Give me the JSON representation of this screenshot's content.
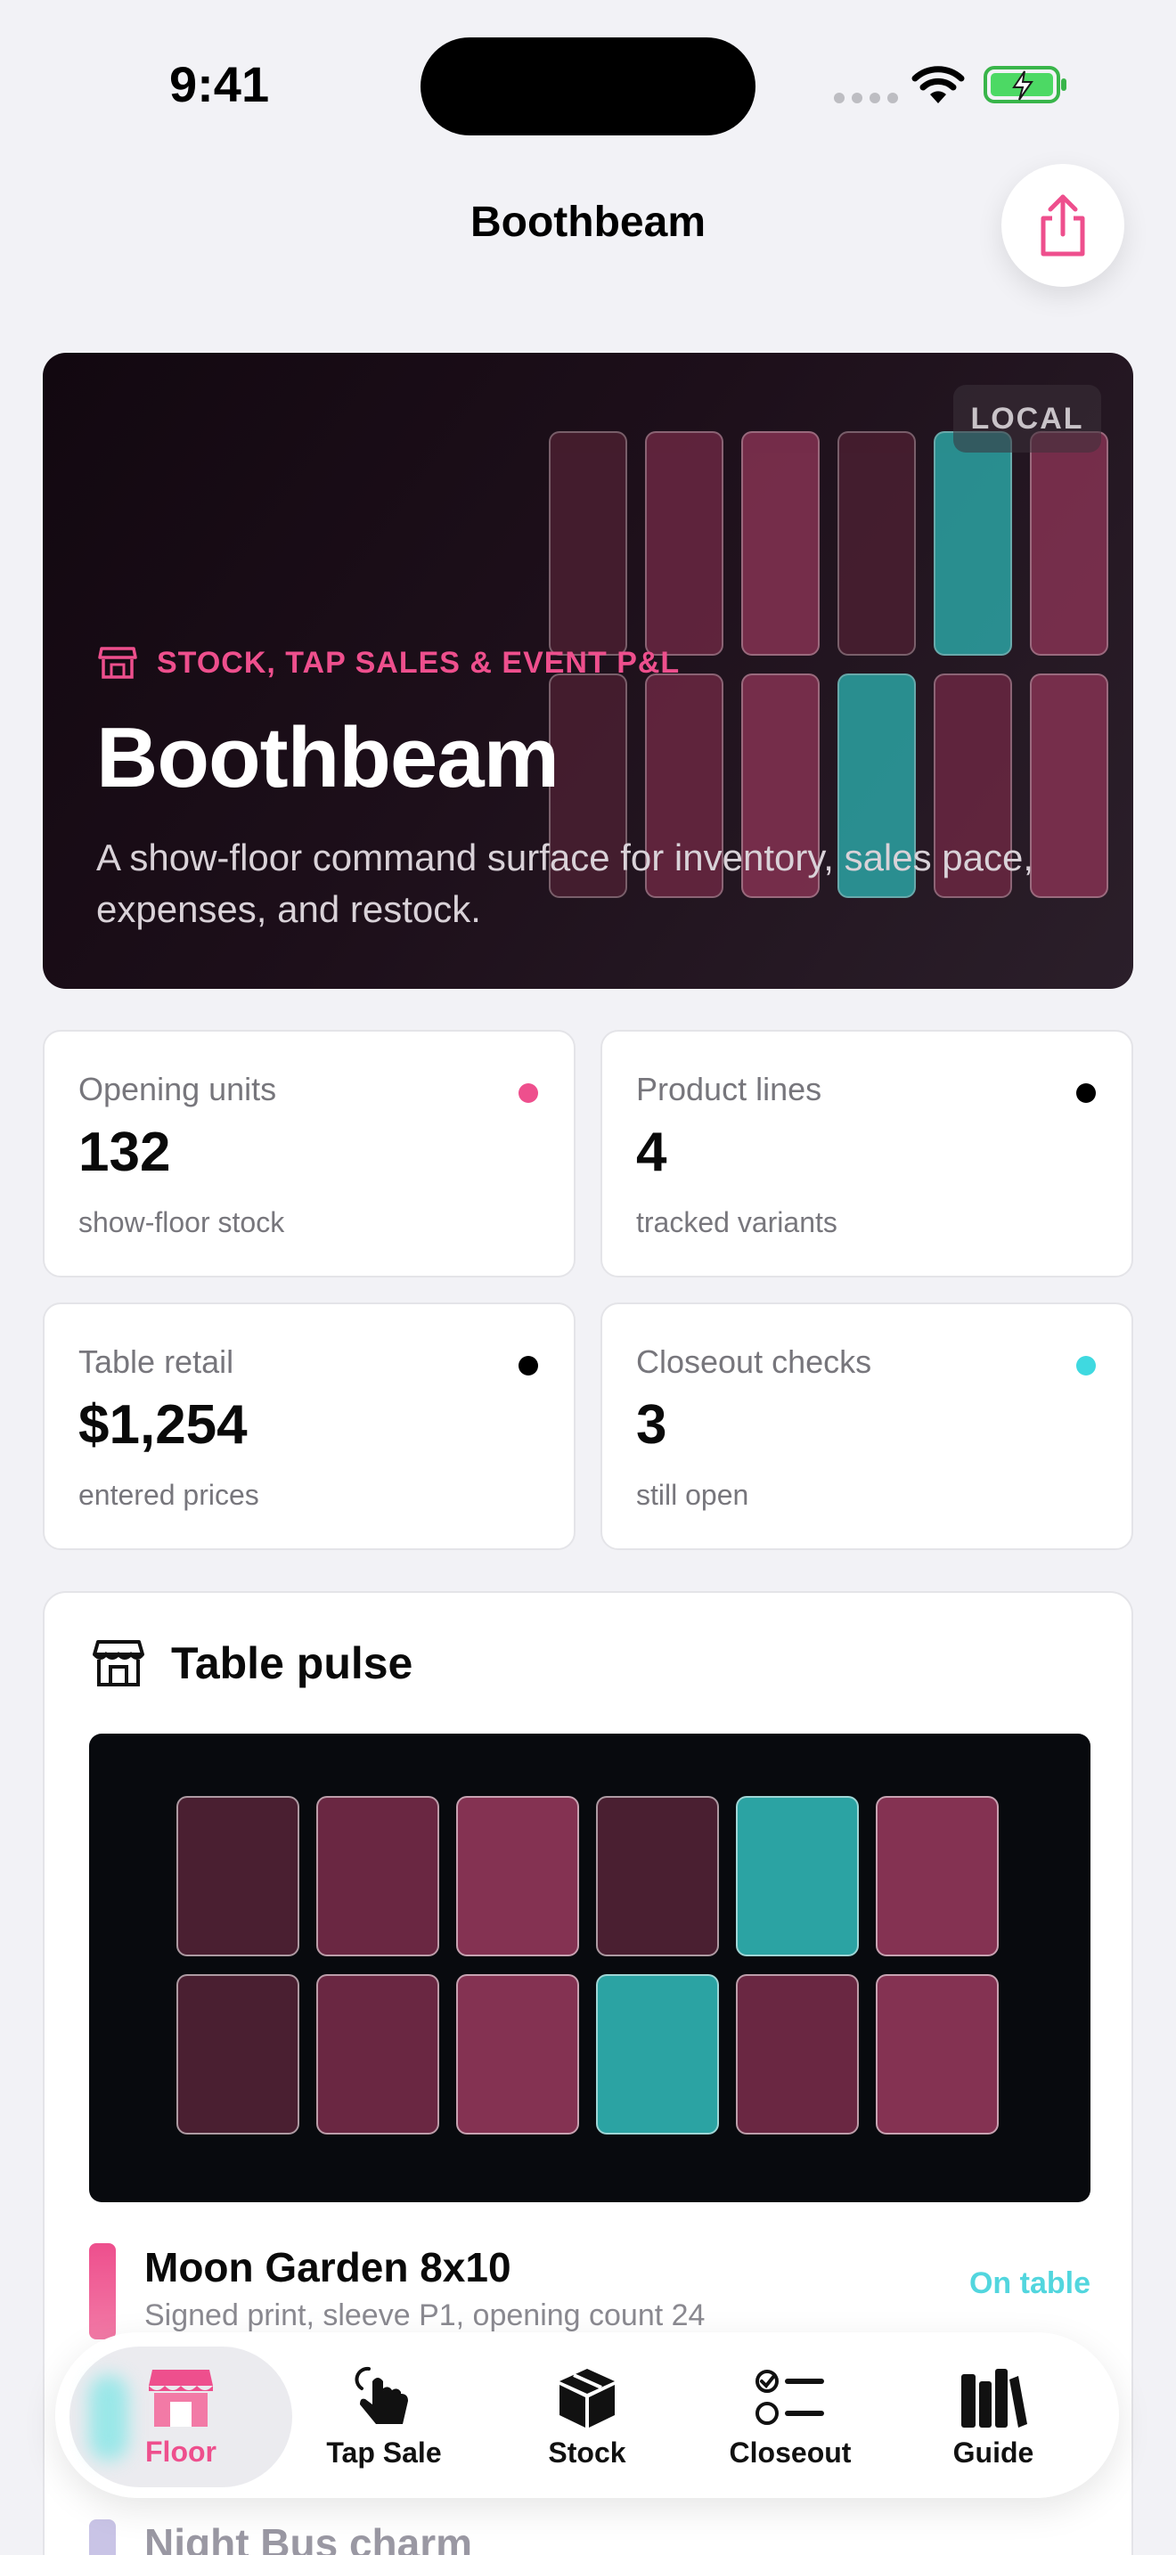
{
  "status_bar": {
    "time": "9:41"
  },
  "header": {
    "title": "Boothbeam",
    "share_icon": "share-icon"
  },
  "hero": {
    "badge": "LOCAL",
    "kicker": "STOCK, TAP SALES & EVENT P&L",
    "title": "Boothbeam",
    "description": "A show-floor command surface for inventory, sales pace, expenses, and restock."
  },
  "stats": [
    {
      "label": "Opening units",
      "value": "132",
      "sub": "show-floor stock",
      "dot_color": "#ee4f8d"
    },
    {
      "label": "Product lines",
      "value": "4",
      "sub": "tracked variants",
      "dot_color": "#000000"
    },
    {
      "label": "Table retail",
      "value": "$1,254",
      "sub": "entered prices",
      "dot_color": "#000000"
    },
    {
      "label": "Closeout checks",
      "value": "3",
      "sub": "still open",
      "dot_color": "#3fd9e0"
    }
  ],
  "pulse": {
    "title": "Table pulse",
    "products": [
      {
        "name": "Moon Garden 8x10",
        "meta": "Signed print, sleeve P1, opening count 24",
        "status": "On table",
        "color": "#ee4f8d"
      },
      {
        "name": "Night Bus charm",
        "meta": "",
        "status": "",
        "color": "#c9c4e6"
      }
    ]
  },
  "tabs": [
    {
      "label": "Floor",
      "icon": "storefront-icon",
      "active": true
    },
    {
      "label": "Tap Sale",
      "icon": "tap-hand-icon",
      "active": false
    },
    {
      "label": "Stock",
      "icon": "box-icon",
      "active": false
    },
    {
      "label": "Closeout",
      "icon": "checklist-icon",
      "active": false
    },
    {
      "label": "Guide",
      "icon": "books-icon",
      "active": false
    }
  ],
  "colors": {
    "accent": "#ee4f8d",
    "teal": "#2ba3a3",
    "tile_dark": "#4a1f31",
    "tile_mid": "#6a2742",
    "tile_light": "#843252"
  }
}
